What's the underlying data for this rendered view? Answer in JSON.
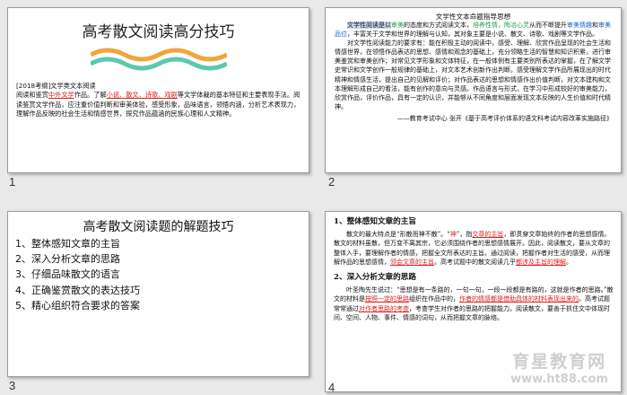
{
  "slides": [
    {
      "number": "1",
      "title": "高考散文阅读高分技巧",
      "wave_colors": [
        "#f0a63c",
        "#5cc7b3"
      ],
      "line1": "[2018考纲]文学类文本阅读",
      "line2_a": "阅读和鉴赏",
      "line2_b": "中外文学",
      "line2_c": "作品。了解",
      "line2_d": "小说、散文、诗歌、戏剧",
      "line2_e": "等文学体裁的基本特征和主要表现手法。阅读鉴赏文学作品，应注重价值判断和审美体验，感受形象，品味语言，领悟内涵，分析艺术表现力，理解作品反映的社会生活和情感世界，探究作品蕴涵的民族心理和人文精神。"
    },
    {
      "number": "2",
      "title": "文学性文本命题指导思想",
      "p1_a": "文学性阅读是以",
      "p1_b": "审美",
      "p1_c": "的态度和方式阅读文本，",
      "p1_d": "培养性情，陶冶心灵",
      "p1_e": "从而不断提升",
      "p1_f": "审美情趣",
      "p1_g": "和",
      "p1_h": "审美品位",
      "p1_i": "，丰富关于文学和世界的理解与认知，其对象主要是小说、散文、诗歌、戏剧等文学作品。",
      "p2": "对文学性阅读能力的要求有：能在积极主动的阅读中，感受、理解、欣赏作品呈现的社会生活和情感世界，在领悟作品表达的思想、感情和观念的基础上，充分领略生活的智慧和知识积累，进行审美鉴赏和审美创作；对常见文学形象和文体特征，在一般体例有主要类别所表达的掌握，在了解文学史常识和文学创作一般规律的基础上，对文本艺术创新作出判断。感受理解文学作品所展现出的时代精神和情感生活，提出自己的见解和评价；对作品表达的思想和情感作出价值判断，对文本建构和文本理解形成自己的看法，能有创作的意向与灵感。作品语言与形式，在学习中形成较好的审美能力，欣赏作品，评价作品，具有一定的认识，并能够从不同角度和层面发现文本反映的人生价值和时代精神。",
      "source": "——教育考试中心 张开《基于高考评价体系的语文科考试内容改革实施路径》"
    },
    {
      "number": "3",
      "title": "高考散文阅读题的解题技巧",
      "items": [
        "1、整体感知文章的主旨",
        "2、深入分析文章的思路",
        "3、仔细品味散文的语言",
        "4、正确鉴赏散文的表达技巧",
        "5、精心组织符合要求的答案"
      ]
    },
    {
      "number": "4",
      "h1": "1、整体感知文章的主旨",
      "p1_a": "散文的最大特点是“形散而神不散”。“",
      "p1_b": "神",
      "p1_c": "”，指",
      "p1_d": "文章的主旨",
      "p1_e": "，即贯穿文章始终的作者的思想感情。散文的材料虽散，但万变不离其宗，它必须围绕作者的思想感情展开。因此，阅读散文，要从文章的整体入手，要理解作者的情感，把握全文所表达的主旨。通过阅读，把握作者对生活的感受，从而理解作品的思想感情，",
      "p1_f": "领会文章的主旨",
      "p1_g": "。高考试题中的散文阅读几乎",
      "p1_h": "都涉及主旨的理解",
      "p1_i": "。",
      "h2": "2、深入分析文章的思路",
      "p2_a": "叶圣陶先生说过：“思想是有一条路的，一句一句，一段一段都是有路的，这就是作者的思路。”散文的材料是",
      "p2_b": "按照一定的思路",
      "p2_c": "组织在作品中的，",
      "p2_d": "作者的情感都是借助具体的材料表现出来的",
      "p2_e": "。高考试题常常通过",
      "p2_f": "对作者思路的考查",
      "p2_g": "，考查学生对作者的思路的把握能力。阅读散文，要善于抓住文中体现时间、空间、人物、事件、情感的词句，从而把握文章的脉络。"
    }
  ],
  "watermark": {
    "line1": "育星教育网",
    "line2": "www.ht88.com"
  }
}
